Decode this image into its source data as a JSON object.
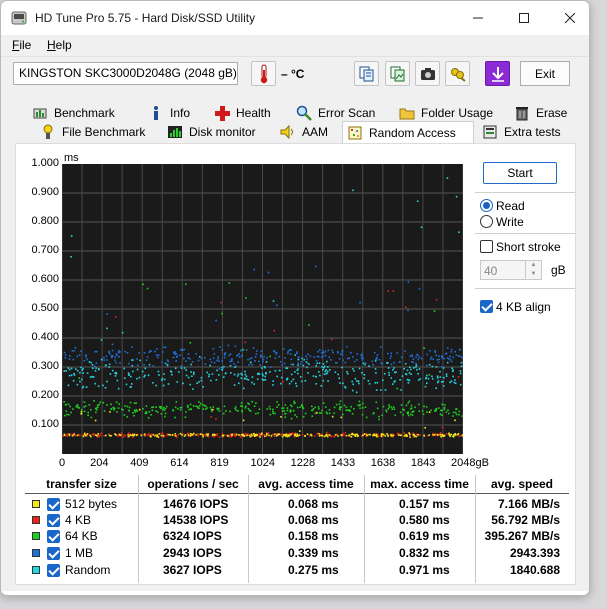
{
  "window": {
    "title": "HD Tune Pro 5.75 - Hard Disk/SSD Utility",
    "menu": [
      {
        "label": "File",
        "accel": "F",
        "rest": "ile"
      },
      {
        "label": "Help",
        "accel": "H",
        "rest": "elp"
      }
    ]
  },
  "toolbar": {
    "drive": "KINGSTON SKC3000D2048G (2048 gB)",
    "temperature": "– °C",
    "exit_label": "Exit",
    "icons": [
      "thermometer-icon",
      "copy-text-icon",
      "copy-image-icon",
      "screenshot-camera-icon",
      "save-keys-icon",
      "download-arrow-icon"
    ]
  },
  "tabs_row1": [
    {
      "label": "Benchmark",
      "icon": "benchmark-icon"
    },
    {
      "label": "Info",
      "icon": "info-icon"
    },
    {
      "label": "Health",
      "icon": "health-cross-icon"
    },
    {
      "label": "Error Scan",
      "icon": "error-scan-magnifier-icon"
    },
    {
      "label": "Folder Usage",
      "icon": "folder-icon"
    },
    {
      "label": "Erase",
      "icon": "trash-icon"
    }
  ],
  "tabs_row2": [
    {
      "label": "File Benchmark",
      "icon": "file-benchmark-icon"
    },
    {
      "label": "Disk monitor",
      "icon": "disk-monitor-icon"
    },
    {
      "label": "AAM",
      "icon": "speaker-icon"
    },
    {
      "label": "Random Access",
      "icon": "random-access-icon",
      "active": true
    },
    {
      "label": "Extra tests",
      "icon": "extra-tests-icon"
    }
  ],
  "controls": {
    "start_label": "Start",
    "read_label": "Read",
    "write_label": "Write",
    "read_selected": true,
    "short_stroke_label": "Short stroke",
    "short_stroke_checked": false,
    "short_stroke_value": "40",
    "short_stroke_unit": "gB",
    "align_label": "4 KB align",
    "align_checked": true
  },
  "chart_data": {
    "type": "scatter",
    "ylabel": "ms",
    "ylim": [
      0,
      1.0
    ],
    "y_ticks": [
      "1.000",
      "0.900",
      "0.800",
      "0.700",
      "0.600",
      "0.500",
      "0.400",
      "0.300",
      "0.200",
      "0.100"
    ],
    "xlim": [
      0,
      2048
    ],
    "x_ticks": [
      "0",
      "204",
      "409",
      "614",
      "819",
      "1024",
      "1228",
      "1433",
      "1638",
      "1843",
      "2048gB"
    ],
    "background": "#1a1a1a",
    "grid": true,
    "series": [
      {
        "name": "512 bytes",
        "color": "#f2ea1c",
        "avg_ms": 0.068,
        "max_ms": 0.157
      },
      {
        "name": "4 KB",
        "color": "#e8261c",
        "avg_ms": 0.068,
        "max_ms": 0.58
      },
      {
        "name": "64 KB",
        "color": "#1fd11f",
        "avg_ms": 0.158,
        "max_ms": 0.619
      },
      {
        "name": "1 MB",
        "color": "#1f6fd6",
        "avg_ms": 0.339,
        "max_ms": 0.832
      },
      {
        "name": "Random",
        "color": "#22d7e0",
        "avg_ms": 0.275,
        "max_ms": 0.971
      }
    ]
  },
  "table": {
    "headers": [
      "transfer size",
      "operations / sec",
      "avg. access time",
      "max. access time",
      "avg. speed"
    ],
    "rows": [
      {
        "size": "512 bytes",
        "ops": "14676 IOPS",
        "avg": "0.068 ms",
        "max": "0.157 ms",
        "speed": "7.166 MB/s",
        "color": "#f2ea1c"
      },
      {
        "size": "4 KB",
        "ops": "14538 IOPS",
        "avg": "0.068 ms",
        "max": "0.580 ms",
        "speed": "56.792 MB/s",
        "color": "#e8261c"
      },
      {
        "size": "64 KB",
        "ops": "6324 IOPS",
        "avg": "0.158 ms",
        "max": "0.619 ms",
        "speed": "395.267 MB/s",
        "color": "#1fd11f"
      },
      {
        "size": "1 MB",
        "ops": "2943 IOPS",
        "avg": "0.339 ms",
        "max": "0.832 ms",
        "speed": "2943.393",
        "color": "#1f6fd6"
      },
      {
        "size": "Random",
        "ops": "3627 IOPS",
        "avg": "0.275 ms",
        "max": "0.971 ms",
        "speed": "1840.688",
        "color": "#22d7e0"
      }
    ]
  }
}
